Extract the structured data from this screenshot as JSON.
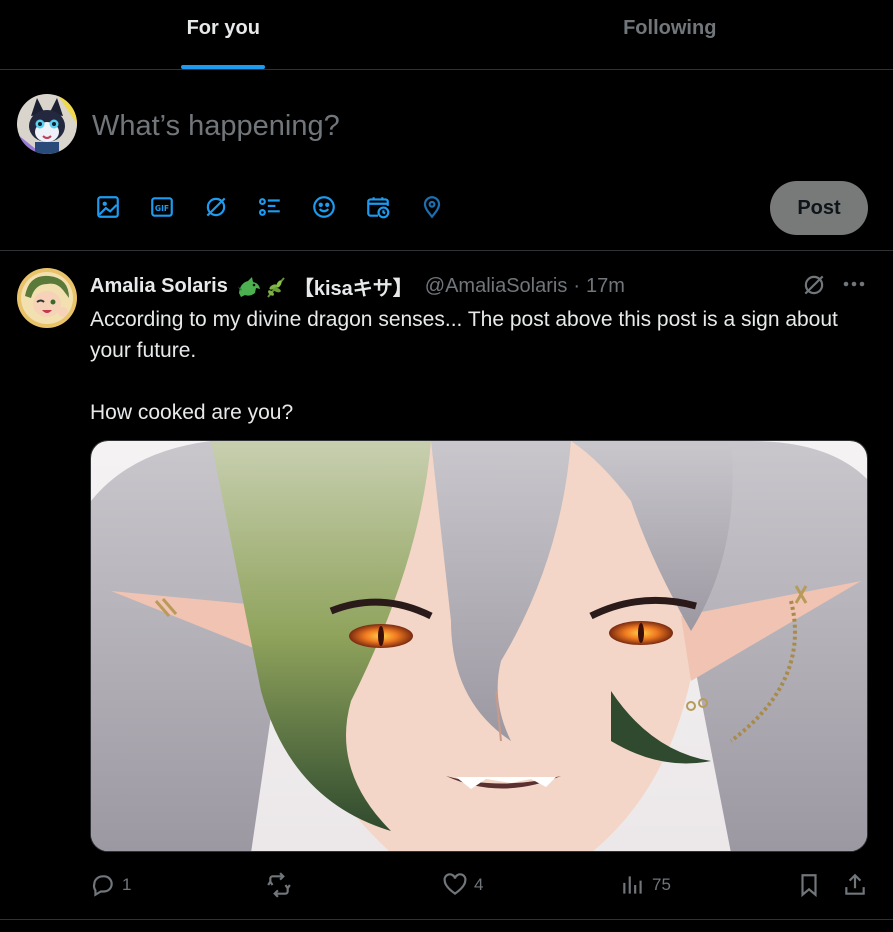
{
  "tabs": [
    {
      "label": "For you",
      "active": true
    },
    {
      "label": "Following",
      "active": false
    }
  ],
  "composer": {
    "placeholder": "What’s happening?",
    "post_label": "Post",
    "tools": [
      "image-icon",
      "gif-icon",
      "grok-icon",
      "poll-icon",
      "emoji-icon",
      "schedule-icon",
      "location-icon"
    ]
  },
  "tweet": {
    "display_name": "Amalia Solaris",
    "name_suffix": "【kisaキサ】",
    "handle": "@AmaliaSolaris",
    "separator": "·",
    "time": "17m",
    "text": "According to my divine dragon senses... The post above this post is a sign about your future.\n\nHow cooked are you?",
    "actions": {
      "replies": "1",
      "reposts": "",
      "likes": "4",
      "views": "75"
    }
  },
  "colors": {
    "accent": "#1d9bf0",
    "muted": "#71767b",
    "border": "#2f3336",
    "post_button_bg": "#787a7a"
  }
}
